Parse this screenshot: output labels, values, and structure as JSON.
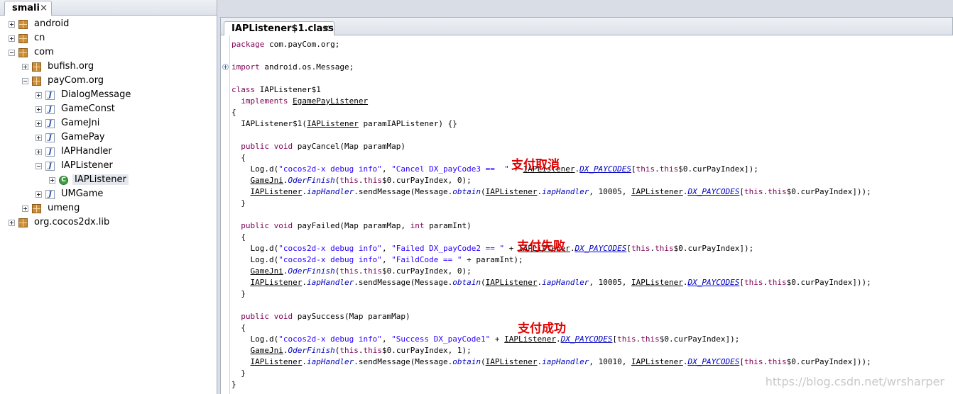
{
  "left_tab": {
    "label": "smali",
    "close": "×"
  },
  "tree": [
    {
      "label": "android",
      "expand": "plus",
      "icon": "package-icon"
    },
    {
      "label": "cn",
      "expand": "plus",
      "icon": "package-icon"
    },
    {
      "label": "com",
      "expand": "minus",
      "icon": "package-icon"
    },
    {
      "label": "bufish.org",
      "expand": "plus",
      "icon": "package-icon"
    },
    {
      "label": "payCom.org",
      "expand": "minus",
      "icon": "package-icon"
    },
    {
      "label": "DialogMessage",
      "expand": "plus",
      "icon": "java-file-icon"
    },
    {
      "label": "GameConst",
      "expand": "plus",
      "icon": "java-file-icon"
    },
    {
      "label": "GameJni",
      "expand": "plus",
      "icon": "java-file-icon"
    },
    {
      "label": "GamePay",
      "expand": "plus",
      "icon": "java-file-icon"
    },
    {
      "label": "IAPHandler",
      "expand": "plus",
      "icon": "java-file-icon"
    },
    {
      "label": "IAPListener",
      "expand": "minus",
      "icon": "java-file-icon"
    },
    {
      "label": "IAPListener",
      "expand": "plus",
      "icon": "class-icon",
      "selected": true
    },
    {
      "label": "UMGame",
      "expand": "plus",
      "icon": "java-file-icon"
    },
    {
      "label": "umeng",
      "expand": "plus",
      "icon": "package-icon"
    },
    {
      "label": "org.cocos2dx.lib",
      "expand": "plus",
      "icon": "package-icon"
    }
  ],
  "editor_tab": {
    "label": "IAPListener$1.class",
    "close": "×"
  },
  "annotations": {
    "cancel": "支付取消",
    "failed": "支付失败",
    "success": "支付成功"
  },
  "watermark": "https://blog.csdn.net/wrsharper",
  "colors": {
    "keyword": "#7f0055",
    "string": "#2a00ff",
    "italic_member": "#0000c0",
    "annotation": "#e00000"
  },
  "code": {
    "l0": [
      [
        "kw",
        "package"
      ],
      [
        "n",
        " com.payCom.org;"
      ]
    ],
    "l2": [
      [
        "kw",
        "import"
      ],
      [
        "n",
        " android.os.Message;"
      ]
    ],
    "l4": [
      [
        "kw",
        "class"
      ],
      [
        "n",
        " IAPListener$1"
      ]
    ],
    "l5": [
      [
        "n",
        "  "
      ],
      [
        "kw",
        "implements"
      ],
      [
        "n",
        " "
      ],
      [
        "u",
        "EgamePayListener"
      ]
    ],
    "l6": [
      [
        "n",
        "{"
      ]
    ],
    "l7": [
      [
        "n",
        "  IAPListener$1("
      ],
      [
        "u",
        "IAPListener"
      ],
      [
        "n",
        " paramIAPListener) {}"
      ]
    ],
    "l9": [
      [
        "n",
        "  "
      ],
      [
        "kw",
        "public void"
      ],
      [
        "n",
        " payCancel(Map paramMap)"
      ]
    ],
    "l10": [
      [
        "n",
        "  {"
      ]
    ],
    "l11": [
      [
        "n",
        "    Log.d("
      ],
      [
        "str",
        "\"cocos2d-x debug info\""
      ],
      [
        "n",
        ", "
      ],
      [
        "str",
        "\"Cancel DX_payCode3 ==  \""
      ],
      [
        "n",
        " + "
      ],
      [
        "u",
        "IAPListener"
      ],
      [
        "n",
        "."
      ],
      [
        "fld",
        "DX_PAYCODES"
      ],
      [
        "n",
        "["
      ],
      [
        "kw",
        "this"
      ],
      [
        "n",
        "."
      ],
      [
        "kw",
        "this"
      ],
      [
        "n",
        "$0.curPayIndex]);"
      ]
    ],
    "l12": [
      [
        "n",
        "    "
      ],
      [
        "u",
        "GameJni"
      ],
      [
        "n",
        "."
      ],
      [
        "it",
        "OderFinish"
      ],
      [
        "n",
        "("
      ],
      [
        "kw",
        "this"
      ],
      [
        "n",
        "."
      ],
      [
        "kw",
        "this"
      ],
      [
        "n",
        "$0.curPayIndex, 0);"
      ]
    ],
    "l13": [
      [
        "n",
        "    "
      ],
      [
        "u",
        "IAPListener"
      ],
      [
        "n",
        "."
      ],
      [
        "it",
        "iapHandler"
      ],
      [
        "n",
        ".sendMessage(Message."
      ],
      [
        "it",
        "obtain"
      ],
      [
        "n",
        "("
      ],
      [
        "u",
        "IAPListener"
      ],
      [
        "n",
        "."
      ],
      [
        "it",
        "iapHandler"
      ],
      [
        "n",
        ", 10005, "
      ],
      [
        "u",
        "IAPListener"
      ],
      [
        "n",
        "."
      ],
      [
        "fld",
        "DX_PAYCODES"
      ],
      [
        "n",
        "["
      ],
      [
        "kw",
        "this"
      ],
      [
        "n",
        "."
      ],
      [
        "kw",
        "this"
      ],
      [
        "n",
        "$0.curPayIndex]));"
      ]
    ],
    "l14": [
      [
        "n",
        "  }"
      ]
    ],
    "l16": [
      [
        "n",
        "  "
      ],
      [
        "kw",
        "public void"
      ],
      [
        "n",
        " payFailed(Map paramMap, "
      ],
      [
        "kw",
        "int"
      ],
      [
        "n",
        " paramInt)"
      ]
    ],
    "l17": [
      [
        "n",
        "  {"
      ]
    ],
    "l18": [
      [
        "n",
        "    Log.d("
      ],
      [
        "str",
        "\"cocos2d-x debug info\""
      ],
      [
        "n",
        ", "
      ],
      [
        "str",
        "\"Failed DX_payCode2 == \""
      ],
      [
        "n",
        " + "
      ],
      [
        "u",
        "IAPListener"
      ],
      [
        "n",
        "."
      ],
      [
        "fld",
        "DX_PAYCODES"
      ],
      [
        "n",
        "["
      ],
      [
        "kw",
        "this"
      ],
      [
        "n",
        "."
      ],
      [
        "kw",
        "this"
      ],
      [
        "n",
        "$0.curPayIndex]);"
      ]
    ],
    "l19": [
      [
        "n",
        "    Log.d("
      ],
      [
        "str",
        "\"cocos2d-x debug info\""
      ],
      [
        "n",
        ", "
      ],
      [
        "str",
        "\"FaildCode == \""
      ],
      [
        "n",
        " + paramInt);"
      ]
    ],
    "l20": [
      [
        "n",
        "    "
      ],
      [
        "u",
        "GameJni"
      ],
      [
        "n",
        "."
      ],
      [
        "it",
        "OderFinish"
      ],
      [
        "n",
        "("
      ],
      [
        "kw",
        "this"
      ],
      [
        "n",
        "."
      ],
      [
        "kw",
        "this"
      ],
      [
        "n",
        "$0.curPayIndex, 0);"
      ]
    ],
    "l21": [
      [
        "n",
        "    "
      ],
      [
        "u",
        "IAPListener"
      ],
      [
        "n",
        "."
      ],
      [
        "it",
        "iapHandler"
      ],
      [
        "n",
        ".sendMessage(Message."
      ],
      [
        "it",
        "obtain"
      ],
      [
        "n",
        "("
      ],
      [
        "u",
        "IAPListener"
      ],
      [
        "n",
        "."
      ],
      [
        "it",
        "iapHandler"
      ],
      [
        "n",
        ", 10005, "
      ],
      [
        "u",
        "IAPListener"
      ],
      [
        "n",
        "."
      ],
      [
        "fld",
        "DX_PAYCODES"
      ],
      [
        "n",
        "["
      ],
      [
        "kw",
        "this"
      ],
      [
        "n",
        "."
      ],
      [
        "kw",
        "this"
      ],
      [
        "n",
        "$0.curPayIndex]));"
      ]
    ],
    "l22": [
      [
        "n",
        "  }"
      ]
    ],
    "l24": [
      [
        "n",
        "  "
      ],
      [
        "kw",
        "public void"
      ],
      [
        "n",
        " paySuccess(Map paramMap)"
      ]
    ],
    "l25": [
      [
        "n",
        "  {"
      ]
    ],
    "l26": [
      [
        "n",
        "    Log.d("
      ],
      [
        "str",
        "\"cocos2d-x debug info\""
      ],
      [
        "n",
        ", "
      ],
      [
        "str",
        "\"Success DX_payCode1\""
      ],
      [
        "n",
        " + "
      ],
      [
        "u",
        "IAPListener"
      ],
      [
        "n",
        "."
      ],
      [
        "fld",
        "DX_PAYCODES"
      ],
      [
        "n",
        "["
      ],
      [
        "kw",
        "this"
      ],
      [
        "n",
        "."
      ],
      [
        "kw",
        "this"
      ],
      [
        "n",
        "$0.curPayIndex]);"
      ]
    ],
    "l27": [
      [
        "n",
        "    "
      ],
      [
        "u",
        "GameJni"
      ],
      [
        "n",
        "."
      ],
      [
        "it",
        "OderFinish"
      ],
      [
        "n",
        "("
      ],
      [
        "kw",
        "this"
      ],
      [
        "n",
        "."
      ],
      [
        "kw",
        "this"
      ],
      [
        "n",
        "$0.curPayIndex, 1);"
      ]
    ],
    "l28": [
      [
        "n",
        "    "
      ],
      [
        "u",
        "IAPListener"
      ],
      [
        "n",
        "."
      ],
      [
        "it",
        "iapHandler"
      ],
      [
        "n",
        ".sendMessage(Message."
      ],
      [
        "it",
        "obtain"
      ],
      [
        "n",
        "("
      ],
      [
        "u",
        "IAPListener"
      ],
      [
        "n",
        "."
      ],
      [
        "it",
        "iapHandler"
      ],
      [
        "n",
        ", 10010, "
      ],
      [
        "u",
        "IAPListener"
      ],
      [
        "n",
        "."
      ],
      [
        "fld",
        "DX_PAYCODES"
      ],
      [
        "n",
        "["
      ],
      [
        "kw",
        "this"
      ],
      [
        "n",
        "."
      ],
      [
        "kw",
        "this"
      ],
      [
        "n",
        "$0.curPayIndex]));"
      ]
    ],
    "l29": [
      [
        "n",
        "  }"
      ]
    ],
    "l30": [
      [
        "n",
        "}"
      ]
    ]
  }
}
